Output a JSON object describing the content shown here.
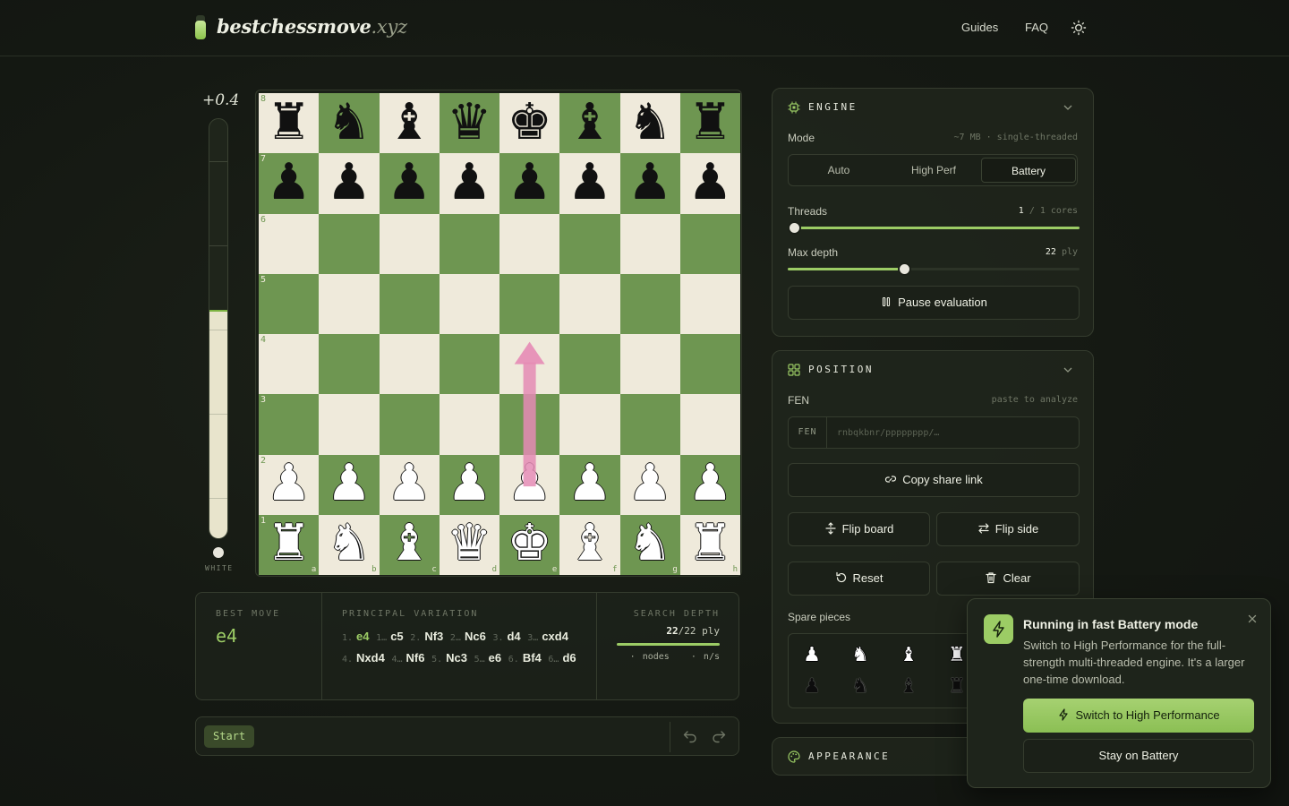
{
  "brand": {
    "name": "bestchessmove",
    "tld": ".xyz"
  },
  "nav": {
    "guides": "Guides",
    "faq": "FAQ",
    "theme_icon": "sun-icon"
  },
  "eval": {
    "score": "+0.4",
    "side": "WHITE",
    "white_fraction": 0.54
  },
  "board": {
    "ranks": [
      "8",
      "7",
      "6",
      "5",
      "4",
      "3",
      "2",
      "1"
    ],
    "files": [
      "a",
      "b",
      "c",
      "d",
      "e",
      "f",
      "g",
      "h"
    ],
    "position": [
      [
        "bR",
        "bN",
        "bB",
        "bQ",
        "bK",
        "bB",
        "bN",
        "bR"
      ],
      [
        "bP",
        "bP",
        "bP",
        "bP",
        "bP",
        "bP",
        "bP",
        "bP"
      ],
      [
        "",
        "",
        "",
        "",
        "",
        "",
        "",
        ""
      ],
      [
        "",
        "",
        "",
        "",
        "",
        "",
        "",
        ""
      ],
      [
        "",
        "",
        "",
        "",
        "",
        "",
        "",
        ""
      ],
      [
        "",
        "",
        "",
        "",
        "",
        "",
        "",
        ""
      ],
      [
        "wP",
        "wP",
        "wP",
        "wP",
        "wP",
        "wP",
        "wP",
        "wP"
      ],
      [
        "wR",
        "wN",
        "wB",
        "wQ",
        "wK",
        "wB",
        "wN",
        "wR"
      ]
    ],
    "arrow": {
      "from": "e2",
      "to": "e4",
      "color": "#e58bb5"
    },
    "light_color": "#efeadb",
    "dark_color": "#6e9651"
  },
  "analysis": {
    "best_move_label": "BEST MOVE",
    "best_move": "e4",
    "pv_label": "PRINCIPAL VARIATION",
    "pv": [
      {
        "num": "1.",
        "move": "e4"
      },
      {
        "num": "1…",
        "move": "c5"
      },
      {
        "num": "2.",
        "move": "Nf3"
      },
      {
        "num": "2…",
        "move": "Nc6"
      },
      {
        "num": "3.",
        "move": "d4"
      },
      {
        "num": "3…",
        "move": "cxd4"
      },
      {
        "num": "4.",
        "move": "Nxd4"
      },
      {
        "num": "4…",
        "move": "Nf6"
      },
      {
        "num": "5.",
        "move": "Nc3"
      },
      {
        "num": "5…",
        "move": "e6"
      },
      {
        "num": "6.",
        "move": "Bf4"
      },
      {
        "num": "6…",
        "move": "d6"
      }
    ],
    "depth_label": "SEARCH DEPTH",
    "depth_current": "22",
    "depth_total": "/22 ply",
    "depth_fraction": 1.0,
    "nodes": "· nodes",
    "nps": "· n/s"
  },
  "movebar": {
    "start": "Start",
    "undo_icon": "undo-icon",
    "redo_icon": "redo-icon"
  },
  "engine": {
    "title": "ENGINE",
    "mode_label": "Mode",
    "mode_hint": "~7 MB · single-threaded",
    "modes": [
      "Auto",
      "High Perf",
      "Battery"
    ],
    "selected_mode": "Battery",
    "threads_label": "Threads",
    "threads_value": "1",
    "threads_suffix": "/ 1 cores",
    "threads_fraction": 0.0,
    "depth_label": "Max depth",
    "depth_value": "22",
    "depth_suffix": "ply",
    "depth_fraction": 0.4,
    "pause_label": "Pause evaluation"
  },
  "position": {
    "title": "POSITION",
    "fen_label": "FEN",
    "fen_hint": "paste to analyze",
    "fen_tag": "FEN",
    "fen_placeholder": "rnbqkbnr/pppppppp/…",
    "copy_label": "Copy share link",
    "flip_board": "Flip board",
    "flip_side": "Flip side",
    "reset": "Reset",
    "clear": "Clear",
    "spare_label": "Spare pieces"
  },
  "appearance": {
    "title": "APPEARANCE"
  },
  "toast": {
    "title": "Running in fast Battery mode",
    "body": "Switch to High Performance for the full-strength multi-threaded engine. It's a larger one-time download.",
    "primary": "Switch to High Performance",
    "secondary": "Stay on Battery"
  },
  "colors": {
    "accent": "#9ccc65",
    "background": "#151913",
    "panel": "#20261c"
  }
}
